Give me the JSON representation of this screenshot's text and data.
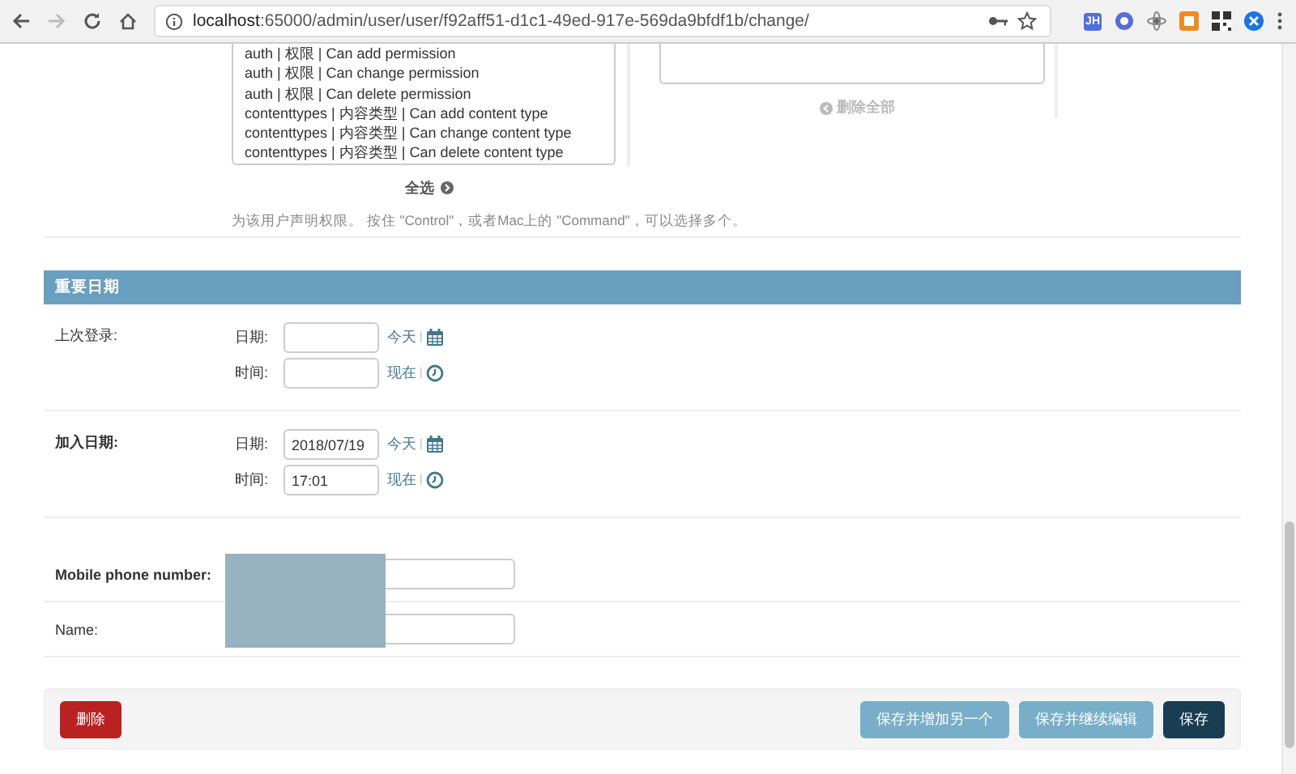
{
  "browser": {
    "url_host": "localhost",
    "url_path": ":65000/admin/user/user/f92aff51-d1c1-49ed-917e-569da9bfdf1b/change/",
    "extension_badge": "JH"
  },
  "permissions": {
    "available": [
      "auth | 权限 | Can add permission",
      "auth | 权限 | Can change permission",
      "auth | 权限 | Can delete permission",
      "contenttypes | 内容类型 | Can add content type",
      "contenttypes | 内容类型 | Can change content type",
      "contenttypes | 内容类型 | Can delete content type"
    ],
    "remove_all": "删除全部",
    "choose_all": "全选",
    "help": "为该用户声明权限。 按住 \"Control\"，或者Mac上的 \"Command\"，可以选择多个。"
  },
  "dates": {
    "title": "重要日期",
    "rows": [
      {
        "label": "上次登录:",
        "required": false,
        "date": {
          "label": "日期:",
          "shortcut": "今天",
          "separator": "|"
        },
        "time": {
          "label": "时间:",
          "shortcut": "现在",
          "separator": "|"
        }
      },
      {
        "label": "加入日期:",
        "required": true,
        "date": {
          "label": "日期:",
          "value": "2018/07/19",
          "shortcut": "今天",
          "separator": "|"
        },
        "time": {
          "label": "时间:",
          "value": "17:01",
          "shortcut": "现在",
          "separator": "|"
        }
      }
    ]
  },
  "fields": [
    {
      "label": "Mobile phone number:",
      "required": true
    },
    {
      "label": "Name:",
      "required": false
    }
  ],
  "submit_row": {
    "delete": "删除",
    "actions": [
      {
        "label": "保存并增加另一个",
        "kind": "secondary"
      },
      {
        "label": "保存并继续编辑",
        "kind": "secondary"
      },
      {
        "label": "保存",
        "kind": "primary"
      }
    ]
  }
}
